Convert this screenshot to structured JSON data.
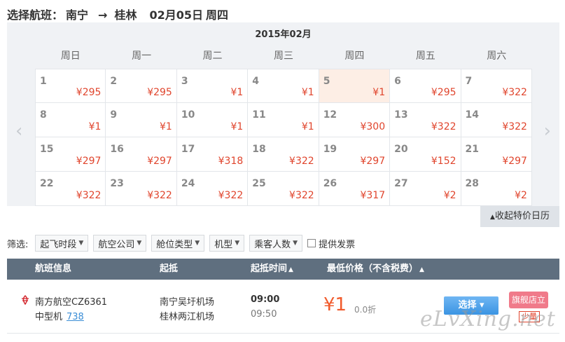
{
  "header": {
    "prefix": "选择航班：",
    "origin": "南宁",
    "arrow": "→",
    "destination": "桂林",
    "date": "02月05日",
    "weekday": "周四"
  },
  "calendar": {
    "month": "2015年02月",
    "prev_icon": "‹",
    "next_icon": "›",
    "weekdays": [
      "周日",
      "周一",
      "周二",
      "周三",
      "周四",
      "周五",
      "周六"
    ],
    "weeks": [
      [
        {
          "day": "1",
          "price": "¥295"
        },
        {
          "day": "2",
          "price": "¥295"
        },
        {
          "day": "3",
          "price": "¥1"
        },
        {
          "day": "4",
          "price": "¥1"
        },
        {
          "day": "5",
          "price": "¥1",
          "selected": true
        },
        {
          "day": "6",
          "price": "¥295"
        },
        {
          "day": "7",
          "price": "¥322"
        }
      ],
      [
        {
          "day": "8",
          "price": "¥1"
        },
        {
          "day": "9",
          "price": "¥1"
        },
        {
          "day": "10",
          "price": "¥1"
        },
        {
          "day": "11",
          "price": "¥1"
        },
        {
          "day": "12",
          "price": "¥300"
        },
        {
          "day": "13",
          "price": "¥322"
        },
        {
          "day": "14",
          "price": "¥322"
        }
      ],
      [
        {
          "day": "15",
          "price": "¥297"
        },
        {
          "day": "16",
          "price": "¥297"
        },
        {
          "day": "17",
          "price": "¥318"
        },
        {
          "day": "18",
          "price": "¥322"
        },
        {
          "day": "19",
          "price": "¥297"
        },
        {
          "day": "20",
          "price": "¥152"
        },
        {
          "day": "21",
          "price": "¥297"
        }
      ],
      [
        {
          "day": "22",
          "price": "¥322"
        },
        {
          "day": "23",
          "price": "¥322"
        },
        {
          "day": "24",
          "price": "¥322"
        },
        {
          "day": "25",
          "price": "¥322"
        },
        {
          "day": "26",
          "price": "¥317"
        },
        {
          "day": "27",
          "price": "¥2"
        },
        {
          "day": "28",
          "price": "¥2"
        }
      ]
    ],
    "collapse_label": "收起特价日历",
    "collapse_icon": "▲"
  },
  "filters": {
    "label": "筛选:",
    "dropdowns": [
      "起飞时段",
      "航空公司",
      "舱位类型",
      "机型",
      "乘客人数"
    ],
    "invoice_label": "提供发票"
  },
  "table": {
    "col_flight": "航班信息",
    "col_airports": "起抵",
    "col_time": "起抵时间",
    "col_price": "最低价格（不含税费）",
    "sort_icon": "▲"
  },
  "flight": {
    "airline": "南方航空CZ6361",
    "plane_size": "中型机",
    "plane_code": "738",
    "depart_airport": "南宁吴圩机场",
    "arrive_airport": "桂林两江机场",
    "depart_time": "09:00",
    "arrive_time": "09:50",
    "price": "¥1",
    "discount": "0.0折",
    "select_label": "选择",
    "select_caret": "▾",
    "promo_label": "旗舰店立减",
    "few_label": "少量"
  },
  "watermark": "eLvXing.net",
  "colors": {
    "price_red": "#e0452d",
    "selected_day_bg": "#fdeee5",
    "table_header_bg": "#5f6f7f",
    "select_button_blue": "#3b94e2",
    "promo_pink": "#f07a8a"
  }
}
